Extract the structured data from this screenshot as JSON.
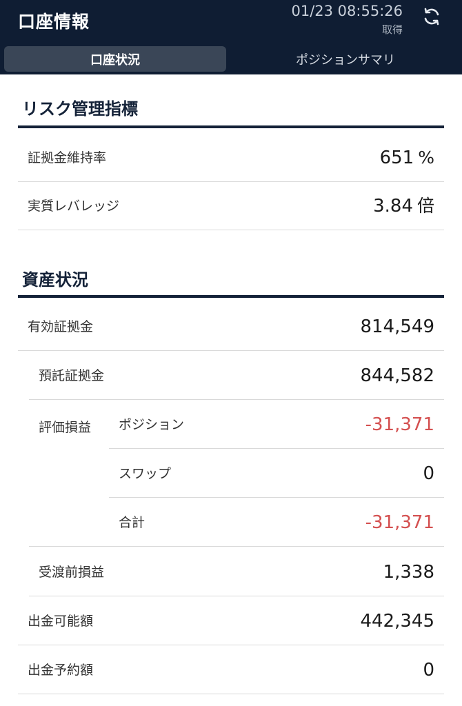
{
  "header": {
    "title": "口座情報",
    "timestamp": "01/23 08:55:26",
    "fetched_label": "取得",
    "refresh_icon": "refresh-icon"
  },
  "tabs": [
    {
      "label": "口座状況",
      "active": true
    },
    {
      "label": "ポジションサマリ",
      "active": false
    }
  ],
  "risk": {
    "title": "リスク管理指標",
    "rows": [
      {
        "label": "証拠金維持率",
        "value": "651",
        "unit": "%"
      },
      {
        "label": "実質レバレッジ",
        "value": "3.84",
        "unit": "倍"
      }
    ]
  },
  "assets": {
    "title": "資産状況",
    "effective_margin": {
      "label": "有効証拠金",
      "value": "814,549"
    },
    "deposit_margin": {
      "label": "預託証拠金",
      "value": "844,582"
    },
    "valuation": {
      "label": "評価損益",
      "position": {
        "label": "ポジション",
        "value": "-31,371"
      },
      "swap": {
        "label": "スワップ",
        "value": "0"
      },
      "total": {
        "label": "合計",
        "value": "-31,371"
      }
    },
    "pre_settlement": {
      "label": "受渡前損益",
      "value": "1,338"
    },
    "withdrawable": {
      "label": "出金可能額",
      "value": "442,345"
    },
    "withdraw_reserved": {
      "label": "出金予約額",
      "value": "0"
    }
  },
  "colors": {
    "header_bg": "#0f1d33",
    "active_tab_bg": "#3a4657",
    "negative": "#d45050"
  }
}
